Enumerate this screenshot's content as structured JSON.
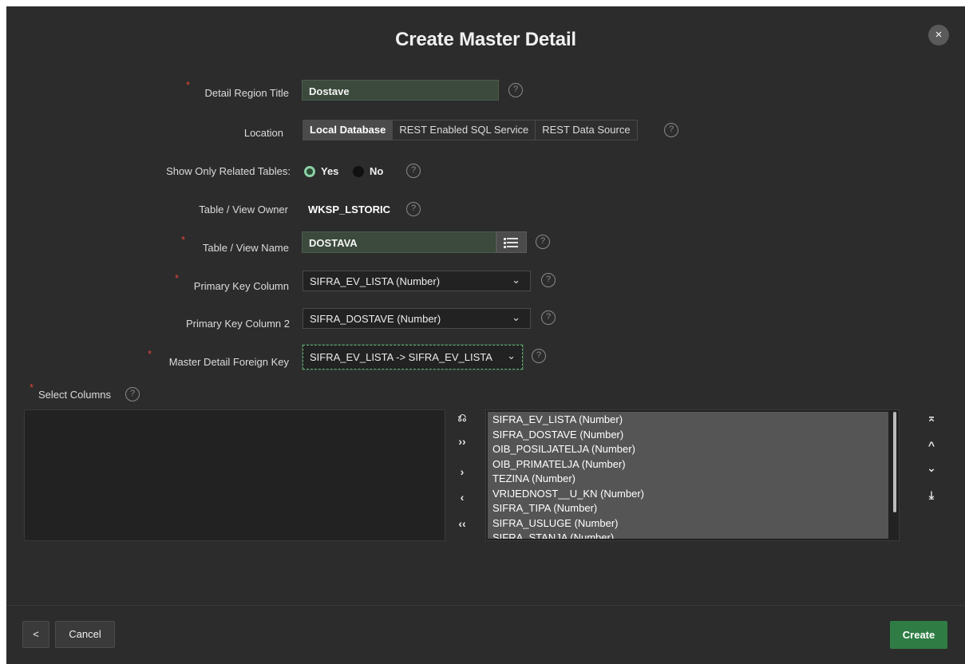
{
  "dialog": {
    "title": "Create Master Detail",
    "close_icon": "×"
  },
  "fields": {
    "detail_region_title": {
      "label": "Detail Region Title",
      "value": "Dostave"
    },
    "location": {
      "label": "Location",
      "options": [
        "Local Database",
        "REST Enabled SQL Service",
        "REST Data Source"
      ],
      "selected": "Local Database"
    },
    "show_only_related": {
      "label": "Show Only Related Tables:",
      "yes": "Yes",
      "no": "No",
      "selected": "Yes"
    },
    "owner": {
      "label": "Table / View Owner",
      "value": "WKSP_LSTORIC"
    },
    "table_name": {
      "label": "Table / View Name",
      "value": "DOSTAVA"
    },
    "pk1": {
      "label": "Primary Key Column",
      "value": "SIFRA_EV_LISTA (Number)"
    },
    "pk2": {
      "label": "Primary Key Column 2",
      "value": "SIFRA_DOSTAVE (Number)"
    },
    "fk": {
      "label": "Master Detail Foreign Key",
      "value": "SIFRA_EV_LISTA -> SIFRA_EV_LISTA"
    },
    "select_columns": {
      "label": "Select Columns"
    }
  },
  "help_icon": "?",
  "required_mark": "*",
  "chevron": "⌄",
  "shuttle": {
    "selected_columns": [
      "SIFRA_EV_LISTA (Number)",
      "SIFRA_DOSTAVE (Number)",
      "OIB_POSILJATELJA (Number)",
      "OIB_PRIMATELJA (Number)",
      "TEZINA (Number)",
      "VRIJEDNOST__U_KN (Number)",
      "SIFRA_TIPA (Number)",
      "SIFRA_USLUGE (Number)",
      "SIFRA_STANJA (Number)"
    ],
    "scroll_fraction": 0.79,
    "buttons": {
      "reset": "⎌",
      "move_all": "››",
      "move": "›",
      "remove": "‹",
      "remove_all": "‹‹",
      "top": "⌅",
      "up": "^",
      "down": "⌄",
      "bottom": "⤓"
    }
  },
  "footer": {
    "back_icon": "<",
    "cancel": "Cancel",
    "create": "Create"
  },
  "colors": {
    "background": "#2c2c2c",
    "accent": "#2f7d44",
    "required": "#e0453a"
  }
}
